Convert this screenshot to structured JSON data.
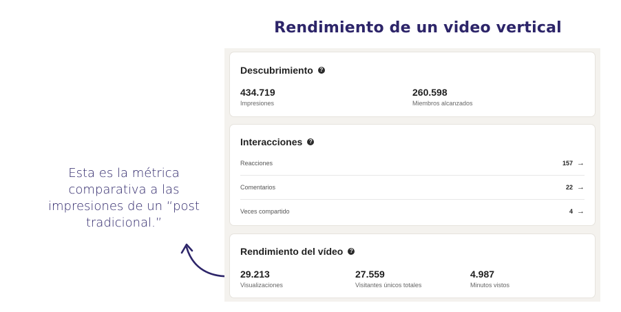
{
  "headline": "Rendimiento de un video vertical",
  "annotation": "Esta es la métrica comparativa a las impresiones de un “post tradicional.”",
  "discovery": {
    "title": "Descubrimiento",
    "help_icon": "?",
    "metrics": [
      {
        "value": "434.719",
        "label": "Impresiones"
      },
      {
        "value": "260.598",
        "label": "Miembros alcanzados"
      }
    ]
  },
  "interactions": {
    "title": "Interacciones",
    "help_icon": "?",
    "rows": [
      {
        "label": "Reacciones",
        "value": "157",
        "arrow": "→"
      },
      {
        "label": "Comentarios",
        "value": "22",
        "arrow": "→"
      },
      {
        "label": "Veces compartido",
        "value": "4",
        "arrow": "→"
      }
    ]
  },
  "video": {
    "title": "Rendimiento del vídeo",
    "help_icon": "?",
    "metrics": [
      {
        "value": "29.213",
        "label": "Visualizaciones"
      },
      {
        "value": "27.559",
        "label": "Visitantes únicos totales"
      },
      {
        "value": "4.987",
        "label": "Minutos vistos"
      }
    ]
  },
  "colors": {
    "accent": "#2d2569",
    "panel_bg": "#f4f2ee"
  }
}
